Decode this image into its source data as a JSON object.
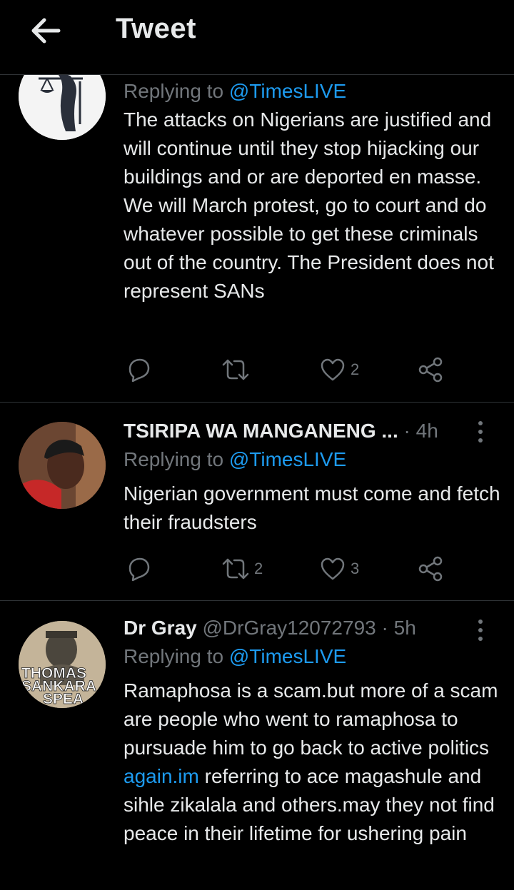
{
  "header": {
    "title": "Tweet"
  },
  "tweets": [
    {
      "replying_prefix": "Replying to",
      "replying_handle": "@TimesLIVE",
      "text": "The attacks on Nigerians are justified and will continue until they stop hijacking our buildings and or are deported en masse. We will March protest, go to court and do whatever possible to get these criminals out of the country. The President does not represent SANs",
      "retweets": "",
      "likes": "2"
    },
    {
      "name": "TSIRIPA WA MANGANENG ...",
      "time": "· 4h",
      "replying_prefix": "Replying to",
      "replying_handle": "@TimesLIVE",
      "text": "Nigerian government must come and fetch their fraudsters",
      "retweets": "2",
      "likes": "3"
    },
    {
      "name": "Dr Gray",
      "handle": "@DrGray12072793",
      "time": "· 5h",
      "replying_prefix": "Replying to",
      "replying_handle": "@TimesLIVE",
      "text_before_link": "Ramaphosa is a scam.but more of a scam are people who went to ramaphosa to pursuade him to go back to active politics ",
      "text_link": "again.im",
      "text_after_link": " referring to ace magashule and sihle zikalala and others.may they not find peace in their lifetime for ushering pain",
      "avatar_text": [
        "THOMAS",
        "SANKARA",
        "SPEA"
      ]
    }
  ],
  "colors": {
    "background": "#000000",
    "text": "#e7e9ea",
    "muted": "#71767b",
    "link": "#1d9bf0",
    "divider": "#2f3336"
  },
  "icons": {
    "back": "arrow-left-icon",
    "reply": "reply-icon",
    "retweet": "retweet-icon",
    "like": "heart-icon",
    "share": "share-icon",
    "more": "more-vertical-icon"
  }
}
